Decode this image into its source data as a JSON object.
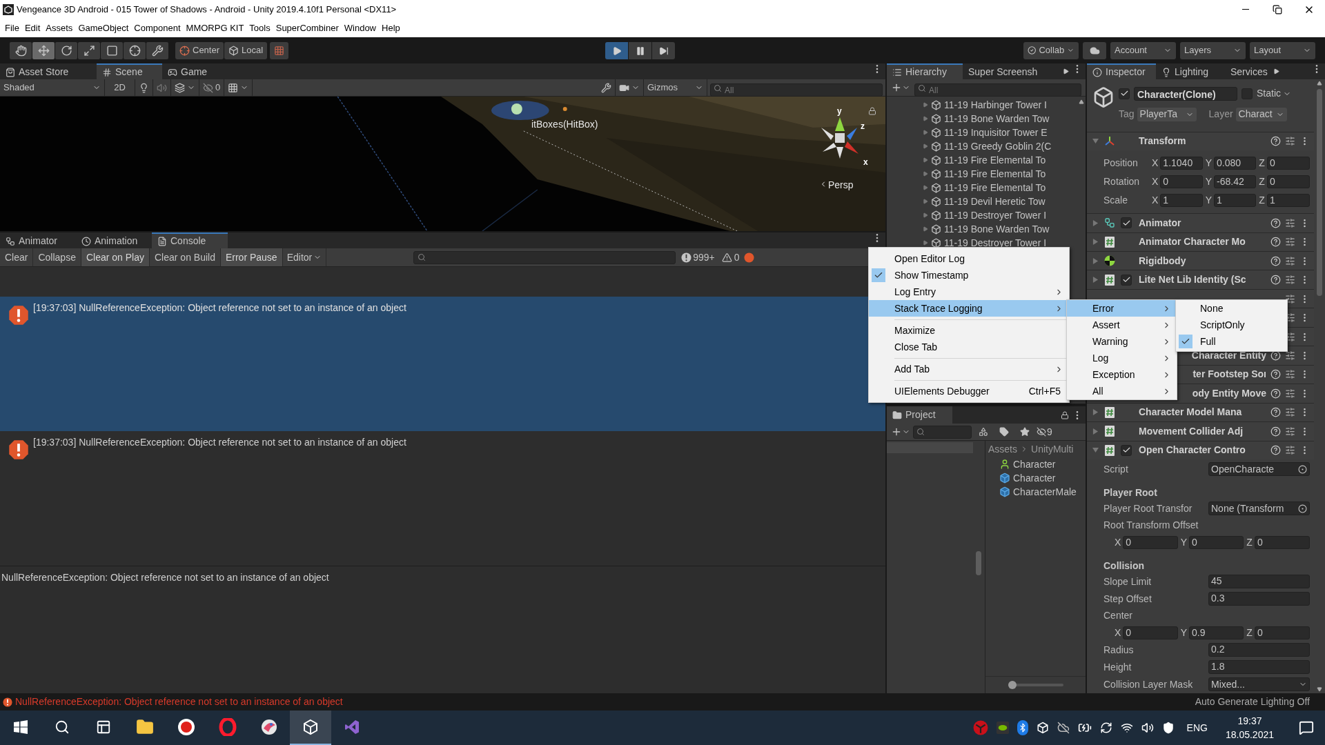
{
  "window": {
    "title": "Vengeance 3D Android - 015 Tower of Shadows - Android - Unity 2019.4.10f1 Personal <DX11>"
  },
  "menu_bar": [
    "File",
    "Edit",
    "Assets",
    "GameObject",
    "Component",
    "MMORPG KIT",
    "Tools",
    "SuperCombiner",
    "Window",
    "Help"
  ],
  "toolbar": {
    "tools": [
      {
        "kind": "hand",
        "selected": false
      },
      {
        "kind": "move",
        "selected": true
      },
      {
        "kind": "rotate",
        "selected": false
      },
      {
        "kind": "scale",
        "selected": false
      },
      {
        "kind": "rect",
        "selected": false
      },
      {
        "kind": "transform",
        "selected": false
      },
      {
        "kind": "custom",
        "selected": false
      }
    ],
    "pivot": "Center",
    "space": "Local",
    "playing": true,
    "paused": false,
    "collab": "Collab",
    "account": "Account",
    "layers": "Layers",
    "layout": "Layout"
  },
  "scene_panel": {
    "tabs": [
      {
        "label": "Asset Store",
        "kind": "store",
        "selected": false
      },
      {
        "label": "Scene",
        "kind": "scene",
        "selected": true
      },
      {
        "label": "Game",
        "kind": "game",
        "selected": false
      }
    ],
    "shading": "Shaded",
    "mode_2d": "2D",
    "hidden_count": "0",
    "gizmos": "Gizmos",
    "search": {
      "placeholder": "All"
    },
    "object_label": "itBoxes(HitBox)",
    "axes": [
      "y",
      "z",
      "x"
    ],
    "projection": "Persp"
  },
  "console": {
    "tabs": [
      {
        "label": "Animator",
        "kind": "animator",
        "selected": false
      },
      {
        "label": "Animation",
        "kind": "animation",
        "selected": false
      },
      {
        "label": "Console",
        "kind": "console",
        "selected": true
      }
    ],
    "buttons": [
      {
        "label": "Clear",
        "on": false
      },
      {
        "label": "Collapse",
        "on": false
      },
      {
        "label": "Clear on Play",
        "on": true
      },
      {
        "label": "Clear on Build",
        "on": false
      },
      {
        "label": "Error Pause",
        "on": true
      }
    ],
    "editor_dropdown": "Editor",
    "error_count": "999+",
    "warning_count": "0",
    "entries": [
      {
        "text": "[19:37:03] NullReferenceException: Object reference not set to an instance of an object",
        "selected": true
      },
      {
        "text": "[19:37:03] NullReferenceException: Object reference not set to an instance of an object",
        "selected": false
      }
    ],
    "detail": "NullReferenceException: Object reference not set to an instance of an object"
  },
  "context_menu": {
    "items": [
      {
        "kind": "item",
        "label": "Open Editor Log",
        "checked": false,
        "highlighted": false,
        "submenu": false
      },
      {
        "kind": "item",
        "label": "Show Timestamp",
        "checked": true,
        "highlighted": false,
        "submenu": false
      },
      {
        "kind": "item",
        "label": "Log Entry",
        "checked": false,
        "highlighted": false,
        "submenu": true
      },
      {
        "kind": "item",
        "label": "Stack Trace Logging",
        "checked": false,
        "highlighted": true,
        "submenu": true
      },
      {
        "kind": "separator"
      },
      {
        "kind": "item",
        "label": "Maximize",
        "checked": false,
        "highlighted": false,
        "submenu": false
      },
      {
        "kind": "item",
        "label": "Close Tab",
        "checked": false,
        "highlighted": false,
        "submenu": false
      },
      {
        "kind": "separator"
      },
      {
        "kind": "item",
        "label": "Add Tab",
        "checked": false,
        "highlighted": false,
        "submenu": true
      },
      {
        "kind": "separator"
      },
      {
        "kind": "item",
        "label": "UIElements Debugger",
        "checked": false,
        "highlighted": false,
        "submenu": false,
        "shortcut": "Ctrl+F5"
      }
    ],
    "submenu": [
      {
        "kind": "item",
        "label": "Error",
        "checked": false,
        "highlighted": true,
        "submenu": true
      },
      {
        "kind": "item",
        "label": "Assert",
        "checked": false,
        "highlighted": false,
        "submenu": true
      },
      {
        "kind": "item",
        "label": "Warning",
        "checked": false,
        "highlighted": false,
        "submenu": true
      },
      {
        "kind": "item",
        "label": "Log",
        "checked": false,
        "highlighted": false,
        "submenu": true
      },
      {
        "kind": "item",
        "label": "Exception",
        "checked": false,
        "highlighted": false,
        "submenu": true
      },
      {
        "kind": "item",
        "label": "All",
        "checked": false,
        "highlighted": false,
        "submenu": true
      }
    ],
    "submenu_2": [
      {
        "kind": "item",
        "label": "None",
        "checked": false,
        "highlighted": false,
        "submenu": false
      },
      {
        "kind": "item",
        "label": "ScriptOnly",
        "checked": false,
        "highlighted": false,
        "submenu": false
      },
      {
        "kind": "item",
        "label": "Full",
        "checked": true,
        "highlighted": false,
        "submenu": false
      }
    ]
  },
  "hierarchy": {
    "tabs": [
      {
        "label": "Hierarchy",
        "selected": true
      },
      {
        "label": "Super Screensh",
        "selected": false
      }
    ],
    "search": {
      "placeholder": "All"
    },
    "items": [
      "11-19 Harbinger Tower I",
      "11-19 Bone Warden Tow",
      "11-19 Inquisitor Tower E",
      "11-19 Greedy Goblin 2(C",
      "11-19 Fire Elemental To",
      "11-19 Fire Elemental To",
      "11-19 Fire Elemental To",
      "11-19 Devil Heretic Tow",
      "11-19 Destroyer Tower I",
      "11-19 Bone Warden Tow",
      "11-19 Destroyer Tower I"
    ]
  },
  "project": {
    "tab": "Project",
    "hidden_count": "9",
    "zoom": {
      "level": 0
    },
    "breadcrumb": [
      "Assets",
      "UnityMulti"
    ],
    "items": [
      {
        "label": "Character",
        "kind": "character"
      },
      {
        "label": "Character",
        "kind": "prefab"
      },
      {
        "label": "CharacterMale",
        "kind": "prefab"
      }
    ]
  },
  "inspector": {
    "tabs": [
      {
        "label": "Inspector",
        "kind": "info",
        "selected": true
      },
      {
        "label": "Lighting",
        "kind": "light",
        "selected": false
      },
      {
        "label": "Services",
        "kind": "none",
        "selected": false
      }
    ],
    "object": {
      "active": true,
      "name": "Character(Clone)",
      "static": false,
      "static_label": "Static",
      "tag_label": "Tag",
      "tag": "PlayerTa",
      "layer_label": "Layer",
      "layer": "Charact"
    },
    "transform": {
      "title": "Transform",
      "expanded": true,
      "rows": [
        {
          "label": "Position",
          "values": [
            {
              "axis": "X",
              "value": "1.1040"
            },
            {
              "axis": "Y",
              "value": "0.080"
            },
            {
              "axis": "Z",
              "value": "0"
            }
          ]
        },
        {
          "label": "Rotation",
          "values": [
            {
              "axis": "X",
              "value": "0"
            },
            {
              "axis": "Y",
              "value": "-68.42"
            },
            {
              "axis": "Z",
              "value": "0"
            }
          ]
        },
        {
          "label": "Scale",
          "values": [
            {
              "axis": "X",
              "value": "1"
            },
            {
              "axis": "Y",
              "value": "1"
            },
            {
              "axis": "Z",
              "value": "1"
            }
          ]
        }
      ]
    },
    "components": [
      {
        "kind": "animator",
        "name": "Animator",
        "enabled": true,
        "expanded": false
      },
      {
        "kind": "script",
        "name": "Animator Character Mo",
        "expanded": false
      },
      {
        "kind": "rigidbody",
        "name": "Rigidbody",
        "expanded": false
      },
      {
        "kind": "script",
        "name": "Lite Net Lib Identity (Sc",
        "enabled": true,
        "expanded": false
      },
      {
        "kind": "covered"
      },
      {
        "kind": "covered"
      },
      {
        "kind": "covered"
      },
      {
        "kind": "covered",
        "name": "Character Entity",
        "partial": true
      },
      {
        "kind": "covered",
        "name": "ter Footstep Soı",
        "partial": true
      },
      {
        "kind": "covered",
        "name": "ody Entity Move",
        "partial": true
      },
      {
        "kind": "script",
        "name": "Character Model Mana",
        "expanded": false
      },
      {
        "kind": "script",
        "name": "Movement Collider Adj",
        "expanded": false
      },
      {
        "kind": "script",
        "name": "Open Character Contro",
        "enabled": true,
        "expanded": true
      }
    ],
    "fields": [
      {
        "kind": "object",
        "label": "Script",
        "value": "OpenCharacte"
      },
      {
        "kind": "header",
        "label": "Player Root"
      },
      {
        "kind": "object",
        "label": "Player Root Transfor",
        "value": "None (Transform"
      },
      {
        "kind": "label",
        "label": "Root Transform Offset"
      },
      {
        "kind": "vector",
        "values": [
          {
            "axis": "X",
            "value": "0"
          },
          {
            "axis": "Y",
            "value": "0"
          },
          {
            "axis": "Z",
            "value": "0"
          }
        ]
      },
      {
        "kind": "header",
        "label": "Collision"
      },
      {
        "kind": "value",
        "label": "Slope Limit",
        "value": "45"
      },
      {
        "kind": "value",
        "label": "Step Offset",
        "value": "0.3"
      },
      {
        "kind": "label",
        "label": "Center"
      },
      {
        "kind": "vector",
        "values": [
          {
            "axis": "X",
            "value": "0"
          },
          {
            "axis": "Y",
            "value": "0.9"
          },
          {
            "axis": "Z",
            "value": "0"
          }
        ]
      },
      {
        "kind": "value",
        "label": "Radius",
        "value": "0.2"
      },
      {
        "kind": "value",
        "label": "Height",
        "value": "1.8"
      },
      {
        "kind": "dropdown",
        "label": "Collision Layer Mask",
        "value": "Mixed..."
      }
    ]
  },
  "status_bar": {
    "message": "NullReferenceException: Object reference not set to an instance of an object",
    "lighting": "Auto Generate Lighting Off"
  },
  "taskbar": {
    "apps": [
      {
        "kind": "start",
        "active": false
      },
      {
        "kind": "search",
        "active": false
      },
      {
        "kind": "taskview",
        "active": false
      },
      {
        "kind": "folder",
        "active": false
      },
      {
        "kind": "record",
        "active": false
      },
      {
        "kind": "ring",
        "active": false
      },
      {
        "kind": "bird",
        "active": false
      },
      {
        "kind": "unity",
        "active": true
      },
      {
        "kind": "studio",
        "active": false
      }
    ],
    "tray": [
      {
        "kind": "disc"
      },
      {
        "kind": "gpu"
      },
      {
        "kind": "bluetooth"
      },
      {
        "kind": "unity"
      },
      {
        "kind": "cloud"
      },
      {
        "kind": "battery"
      },
      {
        "kind": "sync"
      },
      {
        "kind": "wifi"
      },
      {
        "kind": "volume"
      },
      {
        "kind": "shield"
      }
    ],
    "language": "ENG",
    "time": "19:37",
    "date": "18.05.2021"
  }
}
